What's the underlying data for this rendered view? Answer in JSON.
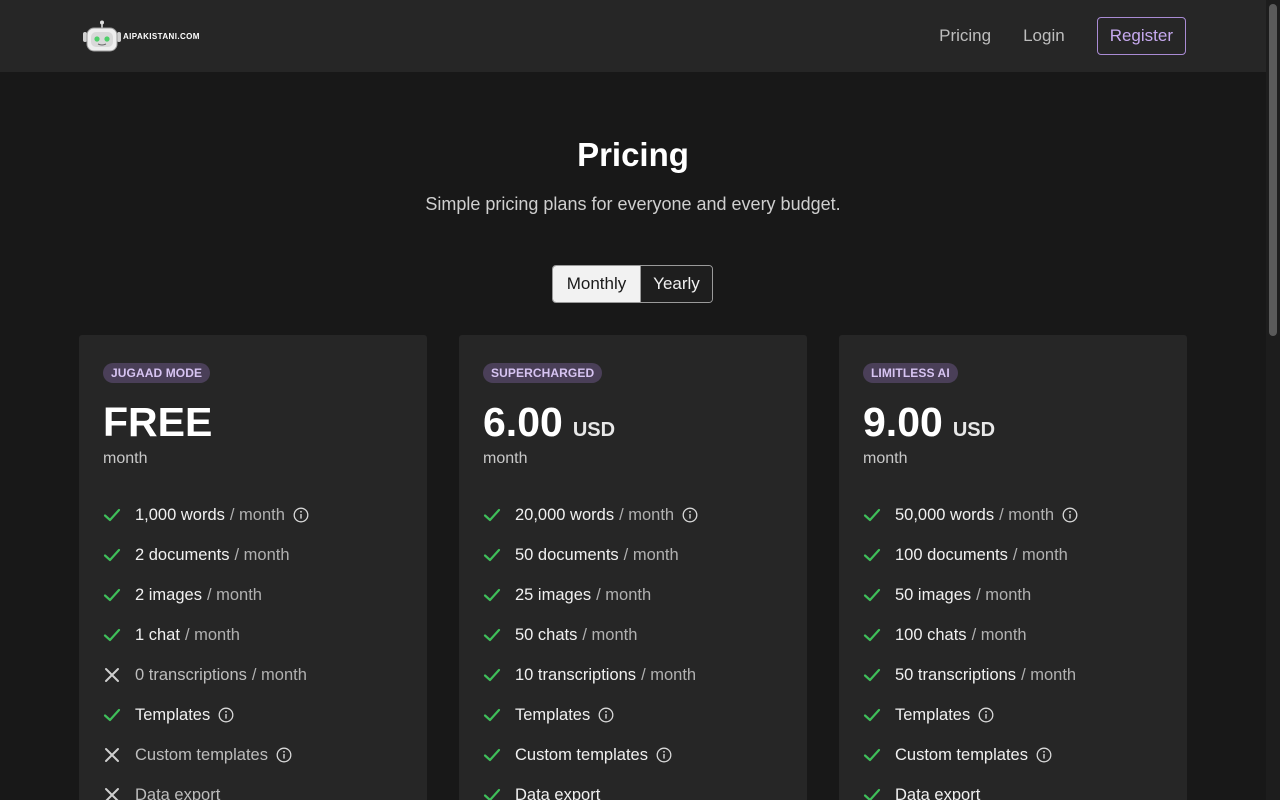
{
  "header": {
    "logo_text": "AIPAKISTANI.COM",
    "nav": {
      "pricing": "Pricing",
      "login": "Login",
      "register": "Register"
    },
    "accent": "#a98bd4"
  },
  "hero": {
    "title": "Pricing",
    "subtitle": "Simple pricing plans for everyone and every budget."
  },
  "billing_toggle": {
    "monthly": "Monthly",
    "yearly": "Yearly",
    "selected": "Monthly"
  },
  "plans": [
    {
      "badge": "JUGAAD MODE",
      "price": "FREE",
      "currency": "",
      "period": "month",
      "features": [
        {
          "main": "1,000 words",
          "suffix": "/ month",
          "included": true,
          "info": true
        },
        {
          "main": "2 documents",
          "suffix": "/ month",
          "included": true,
          "info": false
        },
        {
          "main": "2 images",
          "suffix": "/ month",
          "included": true,
          "info": false
        },
        {
          "main": "1 chat",
          "suffix": "/ month",
          "included": true,
          "info": false
        },
        {
          "main": "0 transcriptions",
          "suffix": "/ month",
          "included": false,
          "info": false
        },
        {
          "main": "Templates",
          "suffix": "",
          "included": true,
          "info": true
        },
        {
          "main": "Custom templates",
          "suffix": "",
          "included": false,
          "info": true
        },
        {
          "main": "Data export",
          "suffix": "",
          "included": false,
          "info": false
        }
      ]
    },
    {
      "badge": "SUPERCHARGED",
      "price": "6.00",
      "currency": "USD",
      "period": "month",
      "features": [
        {
          "main": "20,000 words",
          "suffix": "/ month",
          "included": true,
          "info": true
        },
        {
          "main": "50 documents",
          "suffix": "/ month",
          "included": true,
          "info": false
        },
        {
          "main": "25 images",
          "suffix": "/ month",
          "included": true,
          "info": false
        },
        {
          "main": "50 chats",
          "suffix": "/ month",
          "included": true,
          "info": false
        },
        {
          "main": "10 transcriptions",
          "suffix": "/ month",
          "included": true,
          "info": false
        },
        {
          "main": "Templates",
          "suffix": "",
          "included": true,
          "info": true
        },
        {
          "main": "Custom templates",
          "suffix": "",
          "included": true,
          "info": true
        },
        {
          "main": "Data export",
          "suffix": "",
          "included": true,
          "info": false
        }
      ]
    },
    {
      "badge": "LIMITLESS AI",
      "price": "9.00",
      "currency": "USD",
      "period": "month",
      "features": [
        {
          "main": "50,000 words",
          "suffix": "/ month",
          "included": true,
          "info": true
        },
        {
          "main": "100 documents",
          "suffix": "/ month",
          "included": true,
          "info": false
        },
        {
          "main": "50 images",
          "suffix": "/ month",
          "included": true,
          "info": false
        },
        {
          "main": "100 chats",
          "suffix": "/ month",
          "included": true,
          "info": false
        },
        {
          "main": "50 transcriptions",
          "suffix": "/ month",
          "included": true,
          "info": false
        },
        {
          "main": "Templates",
          "suffix": "",
          "included": true,
          "info": true
        },
        {
          "main": "Custom templates",
          "suffix": "",
          "included": true,
          "info": true
        },
        {
          "main": "Data export",
          "suffix": "",
          "included": true,
          "info": false
        }
      ]
    }
  ],
  "colors": {
    "check": "#3fbf5a",
    "cross": "#cfcfcf",
    "badge_bg": "#4a3f58"
  }
}
